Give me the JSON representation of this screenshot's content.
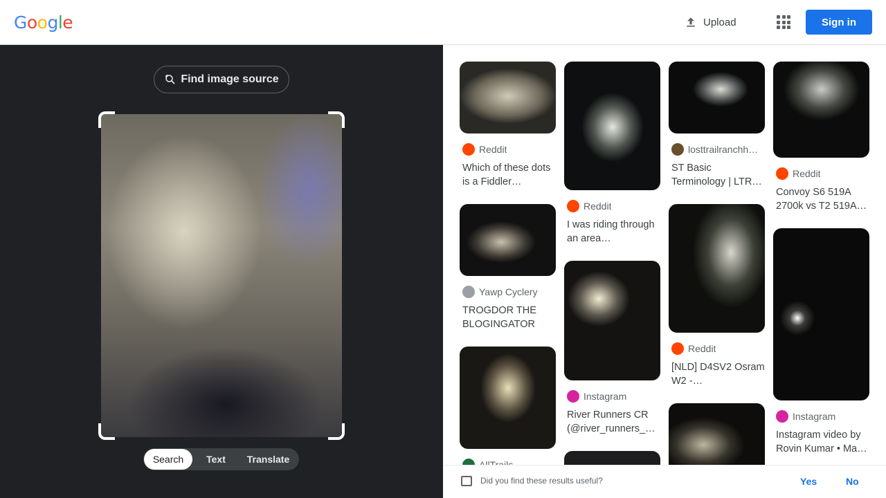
{
  "header": {
    "logo_letters": [
      {
        "ch": "G",
        "color": "#4285F4"
      },
      {
        "ch": "o",
        "color": "#EA4335"
      },
      {
        "ch": "o",
        "color": "#FBBC05"
      },
      {
        "ch": "g",
        "color": "#4285F4"
      },
      {
        "ch": "l",
        "color": "#34A853"
      },
      {
        "ch": "e",
        "color": "#EA4335"
      }
    ],
    "upload_label": "Upload",
    "sign_in_label": "Sign in",
    "accent": "#1a73e8"
  },
  "lens": {
    "find_source_label": "Find image source",
    "modes": [
      {
        "label": "Search",
        "active": true
      },
      {
        "label": "Text",
        "active": false
      },
      {
        "label": "Translate",
        "active": false
      }
    ]
  },
  "results": {
    "columns": [
      [
        {
          "source": "Reddit",
          "icon": "reddit-icon",
          "title": "Which of these dots is a Fiddler…",
          "image": "night-trail-flashlight"
        },
        {
          "source": "Yawp Cyclery",
          "icon": "yawp-cyclery-icon",
          "title": "TROGDOR THE BLOGINGATOR —…",
          "image": "night-rocks-flashlight"
        },
        {
          "source": "AllTrails",
          "icon": "alltrails-icon",
          "title": "",
          "image": "night-dirt-flashlight"
        }
      ],
      [
        {
          "source": "Reddit",
          "icon": "reddit-icon",
          "title": "I was riding through an area…",
          "image": "night-gravel-spot"
        },
        {
          "source": "Instagram",
          "icon": "instagram-icon",
          "title": "River Runners CR (@river_runners_…",
          "image": "night-riverbed-spot"
        },
        {
          "source": "",
          "icon": "",
          "title": "",
          "image": "night-partial"
        }
      ],
      [
        {
          "source": "losttrailranchh…",
          "icon": "losttrailranch-icon",
          "title": "ST Basic Terminology | LTR…",
          "image": "night-beam-ground"
        },
        {
          "source": "Reddit",
          "icon": "reddit-icon",
          "title": "[NLD] D4SV2 Osram W2 -…",
          "image": "night-flashlight-hand"
        },
        {
          "source": "",
          "icon": "",
          "title": "",
          "image": "night-pebbles"
        }
      ],
      [
        {
          "source": "Reddit",
          "icon": "reddit-icon",
          "title": "Convoy S6 519A 2700k vs T2 519A…",
          "image": "night-hand-beam"
        },
        {
          "source": "Instagram",
          "icon": "instagram-icon",
          "title": "Instagram video by Rovin Kumar • Ma…",
          "image": "night-spot-field"
        }
      ]
    ]
  },
  "feedback": {
    "question": "Did you find these results useful?",
    "yes_label": "Yes",
    "no_label": "No"
  }
}
